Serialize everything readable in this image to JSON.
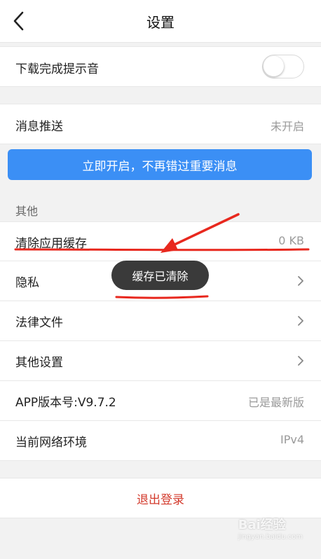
{
  "header": {
    "title": "设置",
    "back_icon": "chevron-left-icon"
  },
  "rows": {
    "download_sound": {
      "label": "下载完成提示音",
      "toggle_on": false
    },
    "push": {
      "label": "消息推送",
      "value": "未开启"
    },
    "banner": "立即开启，不再错过重要消息",
    "section_other": "其他",
    "clear_cache": {
      "label": "清除应用缓存",
      "value": "0 KB"
    },
    "privacy": {
      "label": "隐私"
    },
    "legal": {
      "label": "法律文件"
    },
    "other_settings": {
      "label": "其他设置"
    },
    "version": {
      "label": "APP版本号:V9.7.2",
      "value": "已是最新版"
    },
    "network": {
      "label": "当前网络环境",
      "value": "IPv4"
    }
  },
  "toast": "缓存已清除",
  "logout": "退出登录",
  "watermark": {
    "text": "Bai经验",
    "sub": "jingyan.baidu.com"
  },
  "colors": {
    "banner": "#3b8ff5",
    "logout": "#d33a2c",
    "annotation": "#e8281e"
  }
}
